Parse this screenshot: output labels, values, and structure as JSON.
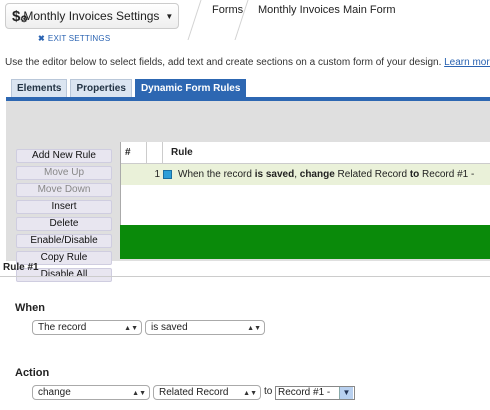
{
  "header": {
    "app_icon": "dollar-gear-icon",
    "app_name": "Monthly Invoices Settings",
    "exit_label": "EXIT SETTINGS",
    "breadcrumb": [
      "Forms",
      "Monthly Invoices Main Form"
    ]
  },
  "intro": {
    "text": "Use the editor below to select fields, add text and create sections on a custom form of your design.",
    "link": "Learn more"
  },
  "tabs": [
    {
      "label": "Elements",
      "active": false
    },
    {
      "label": "Properties",
      "active": false
    },
    {
      "label": "Dynamic Form Rules",
      "active": true
    }
  ],
  "buttons": [
    {
      "label": "Add New Rule",
      "enabled": true
    },
    {
      "label": "Move Up",
      "enabled": false
    },
    {
      "label": "Move Down",
      "enabled": false
    },
    {
      "label": "Insert",
      "enabled": true
    },
    {
      "label": "Delete",
      "enabled": true
    },
    {
      "label": "Enable/Disable",
      "enabled": true
    },
    {
      "label": "Copy Rule",
      "enabled": true
    },
    {
      "label": "Disable All",
      "enabled": true
    }
  ],
  "rules_table": {
    "columns": [
      "#",
      "Rule"
    ],
    "rows": [
      {
        "num": "1",
        "parts": [
          "When the record ",
          "is saved",
          ", ",
          "change",
          " Related Record ",
          "to",
          " Record #1 -"
        ]
      }
    ]
  },
  "rule_detail": {
    "title": "Rule #1",
    "when_label": "When",
    "when_subject": "The record",
    "when_event": "is saved",
    "action_label": "Action",
    "action_verb": "change",
    "action_field": "Related Record",
    "to_label": "to",
    "action_value": "Record #1 -"
  },
  "colors": {
    "accent": "#2d67b2",
    "rule_row": "#eaf1d9",
    "rule_green": "#0a8a0a"
  }
}
